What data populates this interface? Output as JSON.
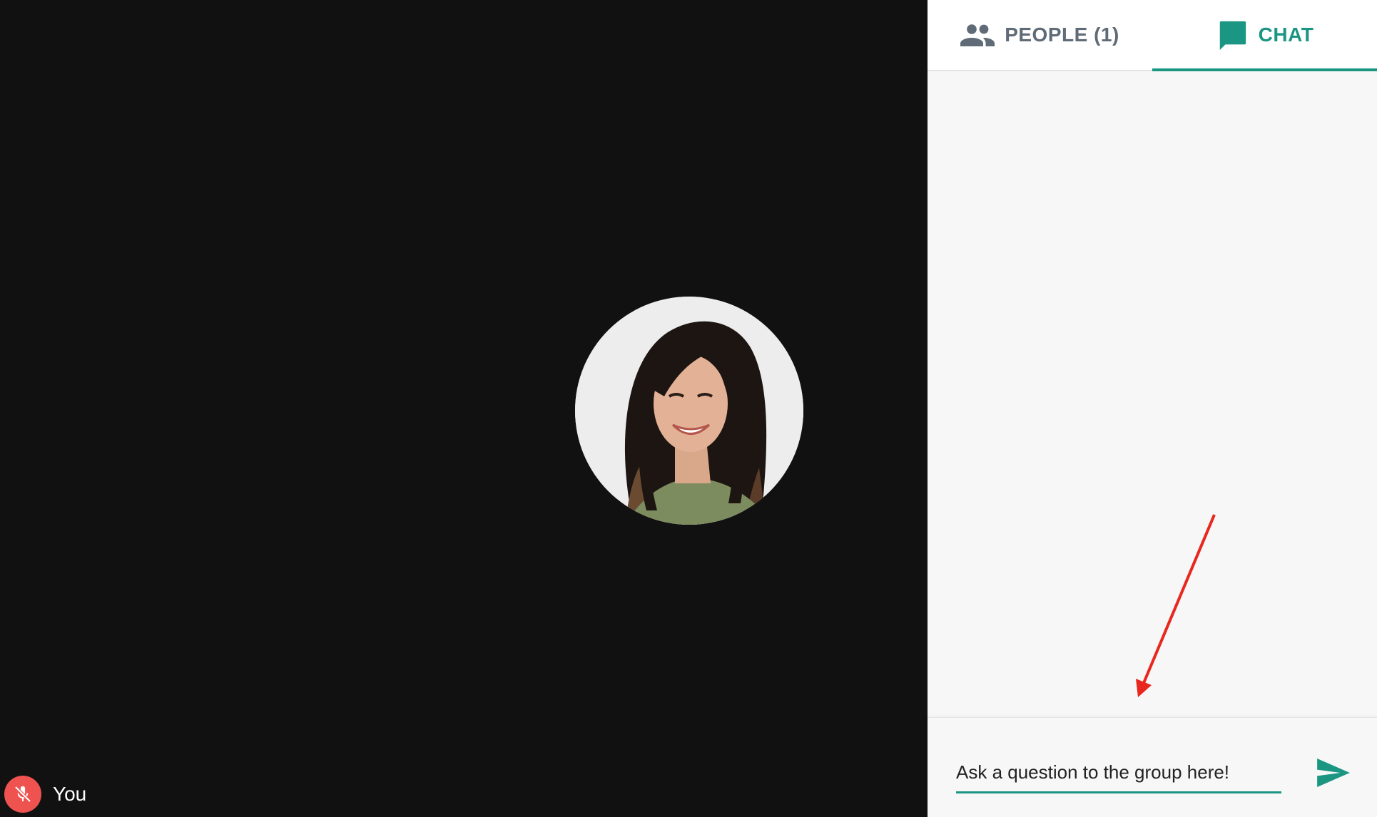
{
  "stage": {
    "avatar_icon": "participant-photo"
  },
  "self_view": {
    "mic_icon": "mic-off-icon",
    "mic_color": "#ef5350",
    "name": "You"
  },
  "panel": {
    "tabs": [
      {
        "label": "PEOPLE (1)",
        "icon": "people-icon",
        "active": false
      },
      {
        "label": "CHAT",
        "icon": "chat-bubble-icon",
        "active": true
      }
    ],
    "accent_color": "#1a9682",
    "inactive_color": "#5f6b76"
  },
  "composer": {
    "placeholder": "Ask a question to the group here!",
    "value": "",
    "send_icon": "send-icon"
  },
  "annotation": {
    "arrow_color": "#e8271e"
  }
}
